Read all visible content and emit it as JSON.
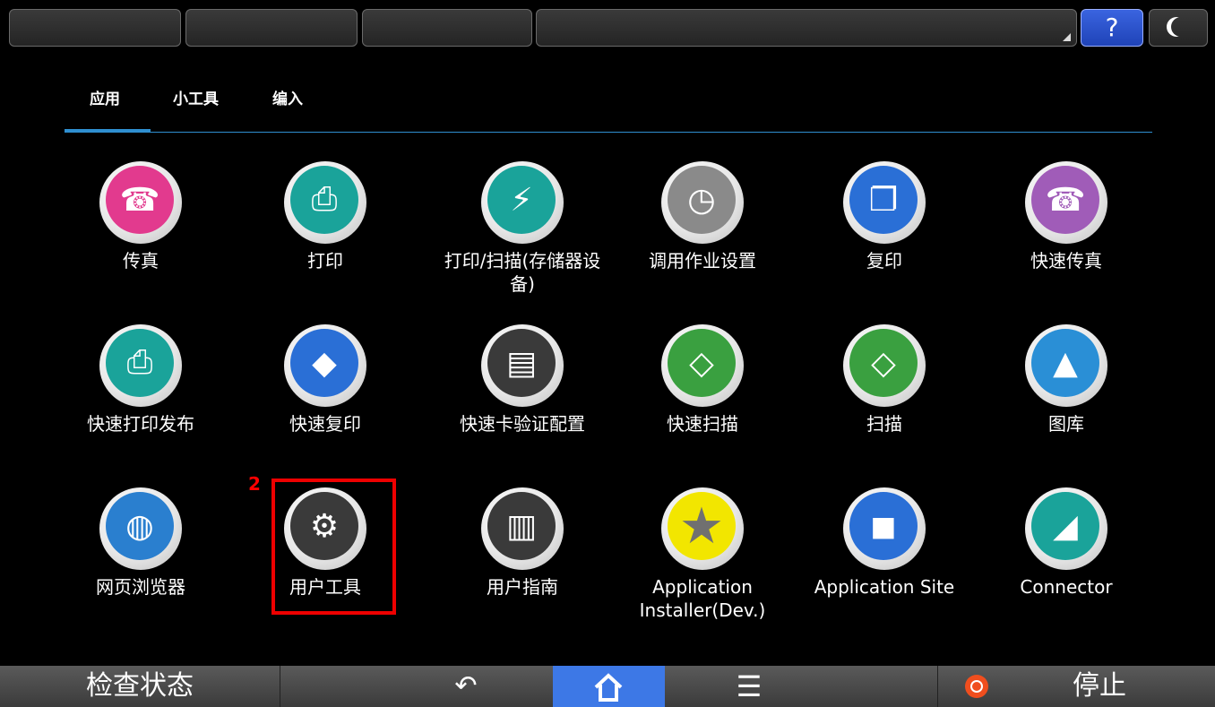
{
  "topbar": {
    "help_label": "?"
  },
  "tabs": [
    "应用",
    "小工具",
    "编入"
  ],
  "apps": [
    {
      "label": "传真",
      "icon": "fax-icon",
      "color": "#e23a8e"
    },
    {
      "label": "打印",
      "icon": "printer-icon",
      "color": "#1aa39a"
    },
    {
      "label": "打印/扫描(存储器设备)",
      "icon": "usb-icon",
      "color": "#1aa39a"
    },
    {
      "label": "调用作业设置",
      "icon": "history-clock-icon",
      "color": "#8a8a8a"
    },
    {
      "label": "复印",
      "icon": "copy-icon",
      "color": "#2a6fd6"
    },
    {
      "label": "快速传真",
      "icon": "quick-fax-icon",
      "color": "#a05cb8"
    },
    {
      "label": "快速打印发布",
      "icon": "quick-print-release-icon",
      "color": "#1aa39a"
    },
    {
      "label": "快速复印",
      "icon": "quick-copy-icon",
      "color": "#2a6fd6"
    },
    {
      "label": "快速卡验证配置",
      "icon": "card-auth-icon",
      "color": "#3a3a3a"
    },
    {
      "label": "快速扫描",
      "icon": "quick-scan-icon",
      "color": "#3aa040"
    },
    {
      "label": "扫描",
      "icon": "scanner-icon",
      "color": "#3aa040"
    },
    {
      "label": "图库",
      "icon": "gallery-icon",
      "color": "#2a8fd6"
    },
    {
      "label": "网页浏览器",
      "icon": "globe-icon",
      "color": "#2a7fcf"
    },
    {
      "label": "用户工具",
      "icon": "gears-icon",
      "color": "#3a3a3a"
    },
    {
      "label": "用户指南",
      "icon": "book-icon",
      "color": "#3a3a3a"
    },
    {
      "label": "Application Installer(Dev.)",
      "icon": "star-icon",
      "color": "#f2e600"
    },
    {
      "label": "Application Site",
      "icon": "shopping-bag-icon",
      "color": "#2a6fd6"
    },
    {
      "label": "Connector",
      "icon": "connector-icon",
      "color": "#1aa39a"
    }
  ],
  "annotation": "2",
  "bottombar": {
    "status_label": "检查状态",
    "back_glyph": "↶",
    "menu_glyph": "☰",
    "stop_label": "停止"
  }
}
